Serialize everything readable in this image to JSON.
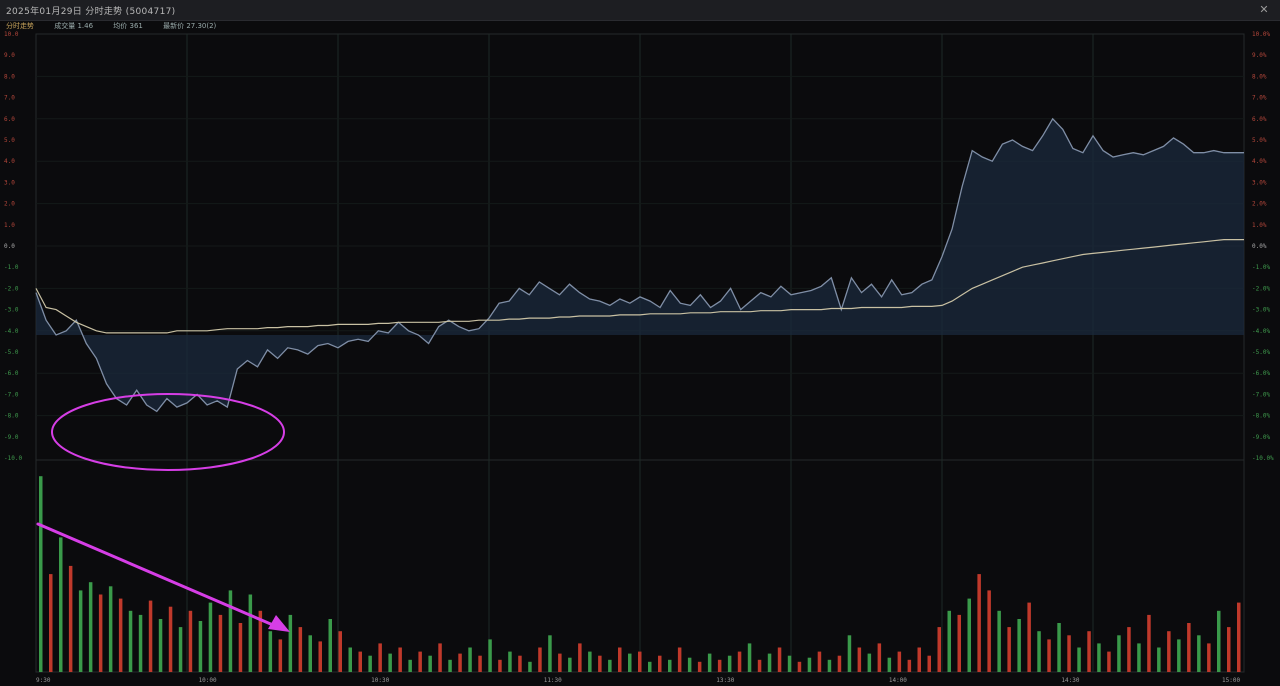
{
  "window": {
    "title": "2025年01月29日  分时走势 (5004717)",
    "close_icon": "close-icon"
  },
  "info_bar": {
    "items": [
      "分时走势",
      "成交量 1.46",
      "均价 361",
      "最新价 27.30(2)"
    ]
  },
  "colors": {
    "price_line": "#7f8ea6",
    "price_fill": "#1b2a3c",
    "avg_line": "#c9c1a3",
    "up": "#c0392b",
    "down": "#3a9a4a",
    "annotation": "#d63ee6",
    "grid": "#1e2a26"
  },
  "x_ticks": [
    "9:30",
    "10:00",
    "10:30",
    "11:30",
    "13:30",
    "14:00",
    "14:30",
    "15:00"
  ],
  "chart_data": {
    "type": "line",
    "title": "",
    "xlabel": "",
    "ylabel": "",
    "grid": true,
    "x_range": [
      0,
      240
    ],
    "y_range": [
      -10,
      10
    ],
    "series": [
      {
        "values_x": [
          0,
          2,
          4,
          6,
          8,
          10,
          12,
          14,
          16,
          18,
          20,
          22,
          24,
          26,
          28,
          30,
          32,
          34,
          36,
          38,
          40,
          42,
          44,
          46,
          48,
          50,
          52,
          54,
          56,
          58,
          60,
          62,
          64,
          66,
          68,
          70,
          72,
          74,
          76,
          78,
          80,
          82,
          84,
          86,
          88,
          90,
          92,
          94,
          96,
          98,
          100,
          102,
          104,
          106,
          108,
          110,
          112,
          114,
          116,
          118,
          120,
          122,
          124,
          126,
          128,
          130,
          132,
          134,
          136,
          138,
          140,
          142,
          144,
          146,
          148,
          150,
          152,
          154,
          156,
          158,
          160,
          162,
          164,
          166,
          168,
          170,
          172,
          174,
          176,
          178,
          180,
          182,
          184,
          186,
          188,
          190,
          192,
          194,
          196,
          198,
          200,
          202,
          204,
          206,
          208,
          210,
          212,
          214,
          216,
          218,
          220,
          222,
          224,
          226,
          228,
          230,
          232,
          234,
          236,
          238,
          240
        ],
        "values_y": [
          -2.2,
          -3.5,
          -4.2,
          -4.0,
          -3.5,
          -4.6,
          -5.3,
          -6.5,
          -7.2,
          -7.5,
          -6.8,
          -7.5,
          -7.8,
          -7.2,
          -7.6,
          -7.4,
          -7.0,
          -7.5,
          -7.3,
          -7.6,
          -5.8,
          -5.4,
          -5.7,
          -4.9,
          -5.3,
          -4.8,
          -4.9,
          -5.1,
          -4.7,
          -4.6,
          -4.8,
          -4.5,
          -4.4,
          -4.5,
          -4.0,
          -4.1,
          -3.6,
          -4.0,
          -4.2,
          -4.6,
          -3.8,
          -3.5,
          -3.8,
          -4.0,
          -3.9,
          -3.4,
          -2.7,
          -2.6,
          -2.0,
          -2.3,
          -1.7,
          -2.0,
          -2.3,
          -1.8,
          -2.2,
          -2.5,
          -2.6,
          -2.8,
          -2.5,
          -2.7,
          -2.4,
          -2.6,
          -2.9,
          -2.1,
          -2.7,
          -2.8,
          -2.3,
          -2.9,
          -2.6,
          -2.0,
          -3.0,
          -2.6,
          -2.2,
          -2.4,
          -1.9,
          -2.3,
          -2.2,
          -2.1,
          -1.9,
          -1.5,
          -3.0,
          -1.5,
          -2.2,
          -1.8,
          -2.4,
          -1.6,
          -2.3,
          -2.2,
          -1.8,
          -1.6,
          -0.5,
          0.8,
          2.8,
          4.5,
          4.2,
          4.0,
          4.8,
          5.0,
          4.7,
          4.5,
          5.2,
          6.0,
          5.5,
          4.6,
          4.4,
          5.2,
          4.5,
          4.2,
          4.3,
          4.4,
          4.3,
          4.5,
          4.7,
          5.1,
          4.8,
          4.4,
          4.4,
          4.5,
          4.4,
          4.4,
          4.4
        ],
        "name": ""
      },
      {
        "values_y_avg": [
          -2.0,
          -2.9,
          -3.0,
          -3.3,
          -3.6,
          -3.8,
          -4.0,
          -4.1,
          -4.1,
          -4.1,
          -4.1,
          -4.1,
          -4.1,
          -4.1,
          -4.0,
          -4.0,
          -4.0,
          -4.0,
          -3.95,
          -3.9,
          -3.9,
          -3.9,
          -3.9,
          -3.85,
          -3.85,
          -3.8,
          -3.8,
          -3.8,
          -3.75,
          -3.75,
          -3.7,
          -3.7,
          -3.7,
          -3.7,
          -3.65,
          -3.65,
          -3.6,
          -3.6,
          -3.6,
          -3.6,
          -3.6,
          -3.55,
          -3.55,
          -3.55,
          -3.5,
          -3.5,
          -3.5,
          -3.45,
          -3.45,
          -3.4,
          -3.4,
          -3.4,
          -3.35,
          -3.35,
          -3.3,
          -3.3,
          -3.3,
          -3.3,
          -3.25,
          -3.25,
          -3.25,
          -3.2,
          -3.2,
          -3.2,
          -3.2,
          -3.15,
          -3.15,
          -3.15,
          -3.1,
          -3.1,
          -3.1,
          -3.1,
          -3.05,
          -3.05,
          -3.05,
          -3.0,
          -3.0,
          -3.0,
          -3.0,
          -2.95,
          -2.95,
          -2.95,
          -2.9,
          -2.9,
          -2.9,
          -2.9,
          -2.9,
          -2.85,
          -2.85,
          -2.85,
          -2.8,
          -2.6,
          -2.3,
          -2.0,
          -1.8,
          -1.6,
          -1.4,
          -1.2,
          -1.0,
          -0.9,
          -0.8,
          -0.7,
          -0.6,
          -0.5,
          -0.4,
          -0.35,
          -0.3,
          -0.25,
          -0.2,
          -0.15,
          -0.1,
          -0.05,
          0.0,
          0.05,
          0.1,
          0.15,
          0.2,
          0.25,
          0.3,
          0.3,
          0.3
        ]
      }
    ],
    "volume": [
      96,
      48,
      66,
      52,
      40,
      44,
      38,
      42,
      36,
      30,
      28,
      35,
      26,
      32,
      22,
      30,
      25,
      34,
      28,
      40,
      24,
      38,
      30,
      20,
      16,
      28,
      22,
      18,
      15,
      26,
      20,
      12,
      10,
      8,
      14,
      9,
      12,
      6,
      10,
      8,
      14,
      6,
      9,
      12,
      8,
      16,
      6,
      10,
      8,
      5,
      12,
      18,
      9,
      7,
      14,
      10,
      8,
      6,
      12,
      9,
      10,
      5,
      8,
      6,
      12,
      7,
      5,
      9,
      6,
      8,
      10,
      14,
      6,
      9,
      12,
      8,
      5,
      7,
      10,
      6,
      8,
      18,
      12,
      9,
      14,
      7,
      10,
      6,
      12,
      8,
      22,
      30,
      28,
      36,
      48,
      40,
      30,
      22,
      26,
      34,
      20,
      16,
      24,
      18,
      12,
      20,
      14,
      10,
      18,
      22,
      14,
      28,
      12,
      20,
      16,
      24,
      18,
      14,
      30,
      22,
      34
    ],
    "volume_dirs": [
      "d",
      "u",
      "d",
      "u",
      "d",
      "d",
      "u",
      "d",
      "u",
      "d",
      "d",
      "u",
      "d",
      "u",
      "d",
      "u",
      "d",
      "d",
      "u",
      "d",
      "u",
      "d",
      "u",
      "d",
      "u",
      "d",
      "u",
      "d",
      "u",
      "d",
      "u",
      "d",
      "u",
      "d",
      "u",
      "d",
      "u",
      "d",
      "u",
      "d",
      "u",
      "d",
      "u",
      "d",
      "u",
      "d",
      "u",
      "d",
      "u",
      "d",
      "u",
      "d",
      "u",
      "d",
      "u",
      "d",
      "u",
      "d",
      "u",
      "d",
      "u",
      "d",
      "u",
      "d",
      "u",
      "d",
      "u",
      "d",
      "u",
      "d",
      "u",
      "d",
      "u",
      "d",
      "u",
      "d",
      "u",
      "d",
      "u",
      "d",
      "u",
      "d",
      "u",
      "d",
      "u",
      "d",
      "u",
      "u",
      "u",
      "u",
      "u",
      "d",
      "u",
      "d",
      "u",
      "u",
      "d",
      "u",
      "d",
      "u",
      "d",
      "u",
      "d",
      "u",
      "d",
      "u",
      "d",
      "u",
      "d",
      "u",
      "d",
      "u",
      "d",
      "u",
      "d",
      "u",
      "d",
      "u",
      "d",
      "u",
      "u"
    ],
    "volume_max": 100
  }
}
